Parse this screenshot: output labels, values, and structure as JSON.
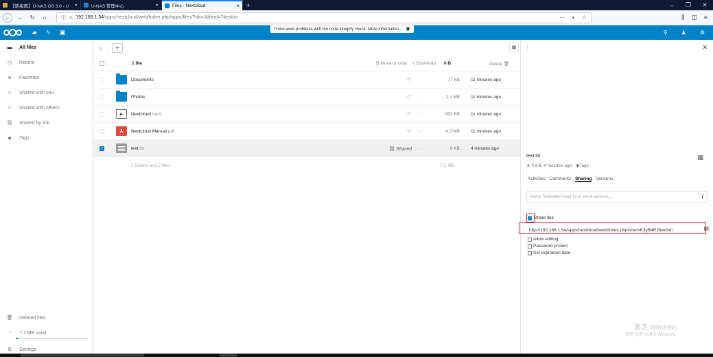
{
  "browser": {
    "tabs": [
      {
        "label": "【新指南】U-NAS OS 3.0 - U",
        "color": "#e8a33d"
      },
      {
        "label": "U-NAS 管理中心",
        "color": "#2d7fd3"
      },
      {
        "label": "Files - Nextcloud",
        "color": "#0082c9"
      }
    ],
    "new_tab": "+",
    "url_host": "192.168.1.54",
    "url_path": "/apps/nextcloud/web/index.php/apps/files/?dir=/&fileid=7#editor"
  },
  "header": {
    "banner_text": "There were problems with the code integrity check. More information…",
    "banner_close": "✖"
  },
  "sidebar": {
    "items": [
      {
        "label": "All files",
        "icon": "▬"
      },
      {
        "label": "Recent",
        "icon": "◷"
      },
      {
        "label": "Favorites",
        "icon": "★"
      },
      {
        "label": "Shared with you",
        "icon": "<"
      },
      {
        "label": "Shared with others",
        "icon": "<"
      },
      {
        "label": "Shared by link",
        "icon": "⛓"
      },
      {
        "label": "Tags",
        "icon": "◆"
      }
    ],
    "deleted": "Deleted files",
    "quota": "7.1 MB used",
    "settings": "Settings"
  },
  "files": {
    "header": {
      "title": "1 file",
      "move": "Move or copy",
      "download": "Download",
      "size": "0 B",
      "delete": "Delete"
    },
    "rows": [
      {
        "name": "Documents",
        "ext": "",
        "type": "folder",
        "size": "77 KB",
        "date": "11 minutes ago"
      },
      {
        "name": "Photos",
        "ext": "",
        "type": "folder",
        "size": "2.3 MB",
        "date": "11 minutes ago"
      },
      {
        "name": "Nextcloud",
        "ext": ".mp4",
        "type": "video",
        "size": "452 KB",
        "date": "11 minutes ago"
      },
      {
        "name": "Nextcloud Manual",
        "ext": ".pdf",
        "type": "pdf",
        "size": "4.3 MB",
        "date": "11 minutes ago"
      },
      {
        "name": "text",
        "ext": ".txt",
        "type": "txt",
        "size": "0 KB",
        "date": "4 minutes ago",
        "shared": "Shared"
      }
    ],
    "summary_count": "2 folders and 3 files",
    "summary_size": "7.1 MB"
  },
  "details": {
    "filename": "text.txt",
    "meta": "0 KB, 4 minutes ago",
    "tags": "Tags",
    "tabs": [
      "Activities",
      "Comments",
      "Sharing",
      "Versions"
    ],
    "share_placeholder": "Name, federated cloud ID or email address…",
    "share_link_label": "Share link",
    "share_link_url": "http://192.168.1.54/apps/nextcloud/web/index.php/s/wrAK3yB4R2ikwmm",
    "options": [
      "Allow editing",
      "Password protect",
      "Set expiration date"
    ]
  },
  "watermark": {
    "line1": "激活 Windows",
    "line2": "转到\"设置\"以激活 Windows。"
  }
}
